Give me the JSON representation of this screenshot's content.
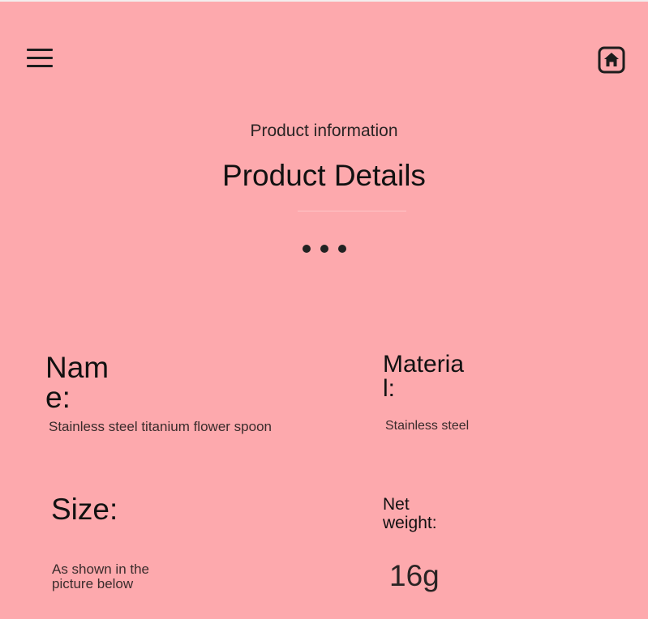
{
  "header": {
    "menu_icon": "hamburger-menu-icon",
    "home_icon": "home-icon"
  },
  "section": {
    "subtitle": "Product information",
    "title": "Product Details"
  },
  "details": {
    "name_label": "Name:",
    "name_value": "Stainless steel titanium flower spoon",
    "material_label": "Material:",
    "material_value": "Stainless steel",
    "size_label": "Size:",
    "size_value": "As shown in the picture below",
    "weight_label": "Net weight:",
    "weight_value": "16g"
  },
  "colors": {
    "background": "#fda9ad",
    "text": "#111111"
  }
}
